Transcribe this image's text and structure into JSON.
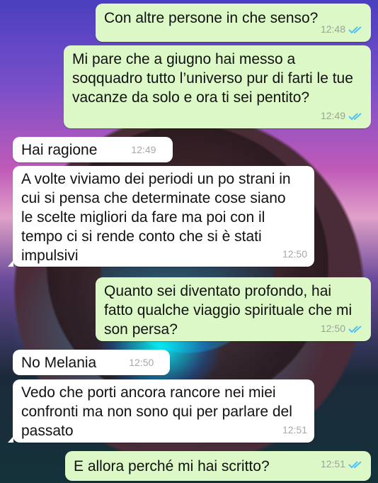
{
  "messages": [
    {
      "text": "Con altre persone in che senso?",
      "time": "12:48"
    },
    {
      "text": "Mi pare che a giugno hai messo a soqquadro tutto l’universo pur di farti le tue vacanze da solo e ora ti sei pentito?",
      "time": "12:49"
    },
    {
      "text": "Hai ragione",
      "time": "12:49"
    },
    {
      "text": "A volte viviamo dei periodi un po strani in cui si pensa che determinate cose siano le scelte migliori da fare ma poi con il tempo ci si rende conto che si è stati impulsivi",
      "time": "12:50"
    },
    {
      "text": "Quanto sei diventato profondo, hai fatto qualche viaggio spirituale che mi son persa?",
      "time": "12:50"
    },
    {
      "text": "No Melania",
      "time": "12:50"
    },
    {
      "text": "Vedo che porti ancora rancore nei miei confronti ma non sono qui per parlare del passato",
      "time": "12:51"
    },
    {
      "text": "E allora perché mi hai scritto?",
      "time": "12:51"
    }
  ],
  "colors": {
    "outgoing_bubble": "#dcf8c6",
    "incoming_bubble": "#ffffff",
    "read_ticks": "#4fc3f7"
  },
  "icons": {
    "read_receipt": "double-check-icon"
  }
}
